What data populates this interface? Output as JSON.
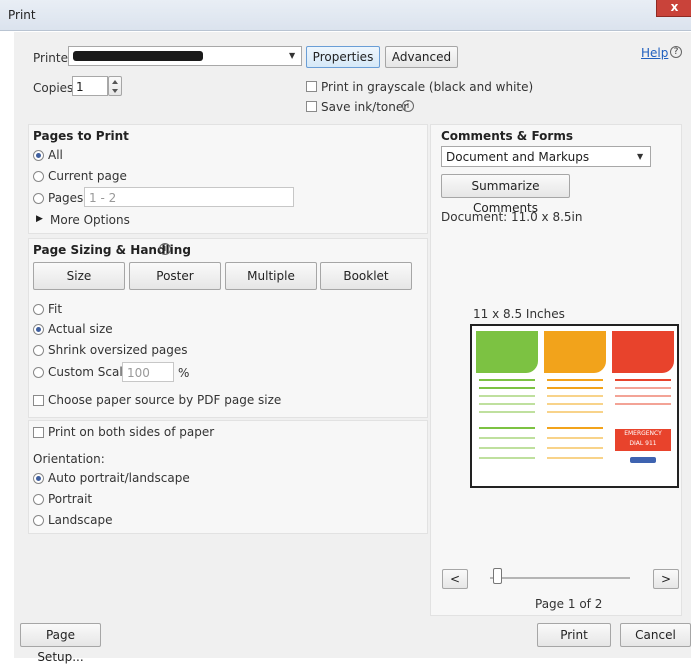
{
  "window": {
    "title": "Print",
    "close_glyph": "x"
  },
  "printer": {
    "label": "Printer:",
    "dropdown_arrow": "▼",
    "properties": "Properties",
    "advanced": "Advanced",
    "help": "Help",
    "help_glyph": "?"
  },
  "copies": {
    "label": "Copies:",
    "value": "1"
  },
  "options": {
    "grayscale": "Print in grayscale (black and white)",
    "save_ink": "Save ink/toner",
    "info_glyph": "i"
  },
  "pages_to_print": {
    "title": "Pages to Print",
    "all": "All",
    "current": "Current page",
    "pages": "Pages",
    "pages_value": "1 - 2",
    "more": "More Options",
    "triangle": "▶"
  },
  "sizing": {
    "title": "Page Sizing & Handling",
    "tabs": [
      "Size",
      "Poster",
      "Multiple",
      "Booklet"
    ],
    "fit": "Fit",
    "actual": "Actual size",
    "shrink": "Shrink oversized pages",
    "custom": "Custom Scale:",
    "custom_value": "100",
    "percent": "%",
    "paper_source": "Choose paper source by PDF page size",
    "both_sides": "Print on both sides of paper",
    "orientation": "Orientation:",
    "auto": "Auto portrait/landscape",
    "portrait": "Portrait",
    "landscape": "Landscape"
  },
  "comments": {
    "title": "Comments & Forms",
    "selected": "Document and Markups",
    "summarize": "Summarize Comments",
    "document_size": "Document: 11.0 x 8.5in",
    "preview_size": "11 x 8.5 Inches",
    "prev": "<",
    "next": ">",
    "page_info": "Page 1 of 2"
  },
  "preview_doc": {
    "emergency": "EMERGENCY",
    "dial": "DIAL 911",
    "colors": {
      "green": "#7cc242",
      "orange": "#f2a31b",
      "red": "#e8432c"
    }
  },
  "footer": {
    "page_setup": "Page Setup...",
    "print": "Print",
    "cancel": "Cancel"
  }
}
